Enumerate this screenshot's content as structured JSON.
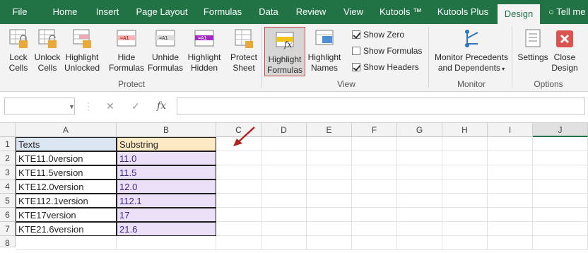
{
  "tabs": [
    "File",
    "Home",
    "Insert",
    "Page Layout",
    "Formulas",
    "Data",
    "Review",
    "View",
    "Kutools ™",
    "Kutools Plus",
    "Design",
    "Tell me"
  ],
  "active_tab": "Design",
  "ribbon": {
    "buttons": {
      "lock_cells": [
        "Lock",
        "Cells"
      ],
      "unlock_cells": [
        "Unlock",
        "Cells"
      ],
      "highlight_unlocked": [
        "Highlight",
        "Unlocked"
      ],
      "hide_formulas": [
        "Hide",
        "Formulas"
      ],
      "unhide_formulas": [
        "Unhide",
        "Formulas"
      ],
      "highlight_hidden": [
        "Highlight",
        "Hidden"
      ],
      "protect_sheet": [
        "Protect",
        "Sheet"
      ],
      "highlight_formulas": [
        "Highlight",
        "Formulas"
      ],
      "highlight_names": [
        "Highlight",
        "Names"
      ],
      "monitor_precedents": [
        "Monitor Precedents",
        "and Dependents"
      ],
      "settings": [
        "Settings"
      ],
      "close_design": [
        "Close",
        "Design"
      ]
    },
    "checkboxes": [
      {
        "label": "Show Zero",
        "checked": true
      },
      {
        "label": "Show Formulas",
        "checked": false
      },
      {
        "label": "Show Headers",
        "checked": true
      }
    ],
    "groups": {
      "protect": "Protect",
      "view": "View",
      "monitor": "Monitor",
      "options": "Options"
    }
  },
  "formula_bar": {
    "name_box": "",
    "formula": "",
    "fx": "fx"
  },
  "sheet": {
    "columns": [
      "A",
      "B",
      "C",
      "D",
      "E",
      "F",
      "G",
      "H",
      "I",
      "J"
    ],
    "selected_column": "J",
    "rows": [
      "1",
      "2",
      "3",
      "4",
      "5",
      "6",
      "7",
      "8"
    ],
    "header_row": {
      "a": "Texts",
      "b": "Substring"
    },
    "data": [
      {
        "a": "KTE11.0version",
        "b": "11.0"
      },
      {
        "a": "KTE11.5version",
        "b": "11.5"
      },
      {
        "a": "KTE12.0version",
        "b": "12.0"
      },
      {
        "a": "KTE112.1version",
        "b": "112.1"
      },
      {
        "a": "KTE17version",
        "b": "17"
      },
      {
        "a": "KTE21.6version",
        "b": "21.6"
      }
    ]
  },
  "colors": {
    "brand": "#217346",
    "header_a_fill": "#dce6f1",
    "header_b_fill": "#fde9c4",
    "substring_fill": "#ecdff8",
    "annotation_arrow": "#b22222"
  }
}
